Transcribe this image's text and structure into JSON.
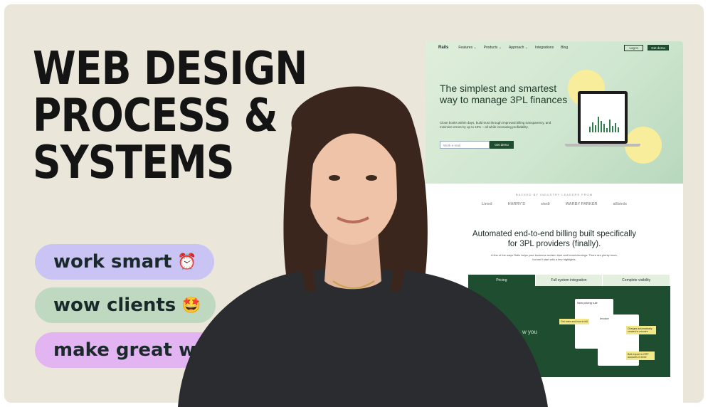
{
  "headline": {
    "line1": "WEB DESIGN",
    "line2": "PROCESS &",
    "line3": "SYSTEMS"
  },
  "pills": [
    {
      "label": "work smart",
      "emoji": "⏰",
      "color": "#c9c4f4"
    },
    {
      "label": "wow clients",
      "emoji": "🤩",
      "color": "#bfd9c0"
    },
    {
      "label": "make great work",
      "emoji": "💪",
      "color": "#e2b4f2"
    }
  ],
  "site": {
    "nav": {
      "logo": "Rails",
      "items": [
        "Features ⌄",
        "Products ⌄",
        "Approach ⌄",
        "Integrations",
        "Blog"
      ],
      "login": "Log In",
      "cta": "Get demo"
    },
    "hero": {
      "title": "The simplest and smartest way to manage 3PL finances",
      "subtitle": "Close books within days, build trust through improved billing transparency, and minimize errors by up to 10% – all while increasing profitability.",
      "email_placeholder": "Work e-mail",
      "button": "Get demo"
    },
    "backed": "BACKED BY INDUSTRY LEADERS FROM",
    "logos": [
      "Lined",
      "HARRY'S",
      "stedi",
      "WARBY PARKER",
      "allbirds"
    ],
    "section": {
      "title": "Automated end-to-end billing built specifically for 3PL providers (finally).",
      "subtitle": "A few of the ways Rails helps your business reclaim time and boost earnings. There are plenty more, but we'll start with a few highlights."
    },
    "tabs": [
      "Pricing",
      "Full system integration",
      "Complete visibility"
    ],
    "panel_text": "w you",
    "card_title": "New pricing rule",
    "card2_title": "Invoice",
    "notes": [
      "Get rates and how to bill",
      "Charges automatically created in minutes",
      "Bulk export to ERP accounts in three"
    ]
  },
  "colors": {
    "background": "#ebe6da",
    "accent_green": "#1f4d2f"
  }
}
